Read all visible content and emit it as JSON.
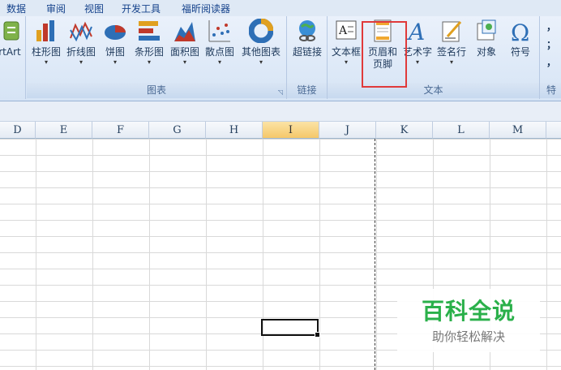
{
  "tabs": [
    "数据",
    "审阅",
    "视图",
    "开发工具",
    "福昕阅读器"
  ],
  "ribbon": {
    "smartart_label": "rtArt",
    "chart_group": {
      "label": "图表",
      "buttons": [
        "柱形图",
        "折线图",
        "饼图",
        "条形图",
        "面积图",
        "散点图",
        "其他图表"
      ]
    },
    "link_group": {
      "label": "链接",
      "hyperlink": "超链接"
    },
    "text_group": {
      "label": "文本",
      "textbox": "文本框",
      "header_footer_line1": "页眉和",
      "header_footer_line2": "页脚",
      "wordart": "艺术字",
      "signature": "签名行",
      "object": "对象",
      "symbol": "符号"
    },
    "special_label": "特",
    "punct1": "，",
    "punct2": "；",
    "punct3": "，"
  },
  "columns": [
    "D",
    "E",
    "F",
    "G",
    "H",
    "I",
    "J",
    "K",
    "L",
    "M"
  ],
  "selected_column": "I",
  "watermark": {
    "title": "百科全说",
    "subtitle": "助你轻松解决"
  },
  "colors": {
    "highlight": "#e03a3a",
    "selected_header": "#f5c86a",
    "watermark_green": "#2ab04a"
  }
}
